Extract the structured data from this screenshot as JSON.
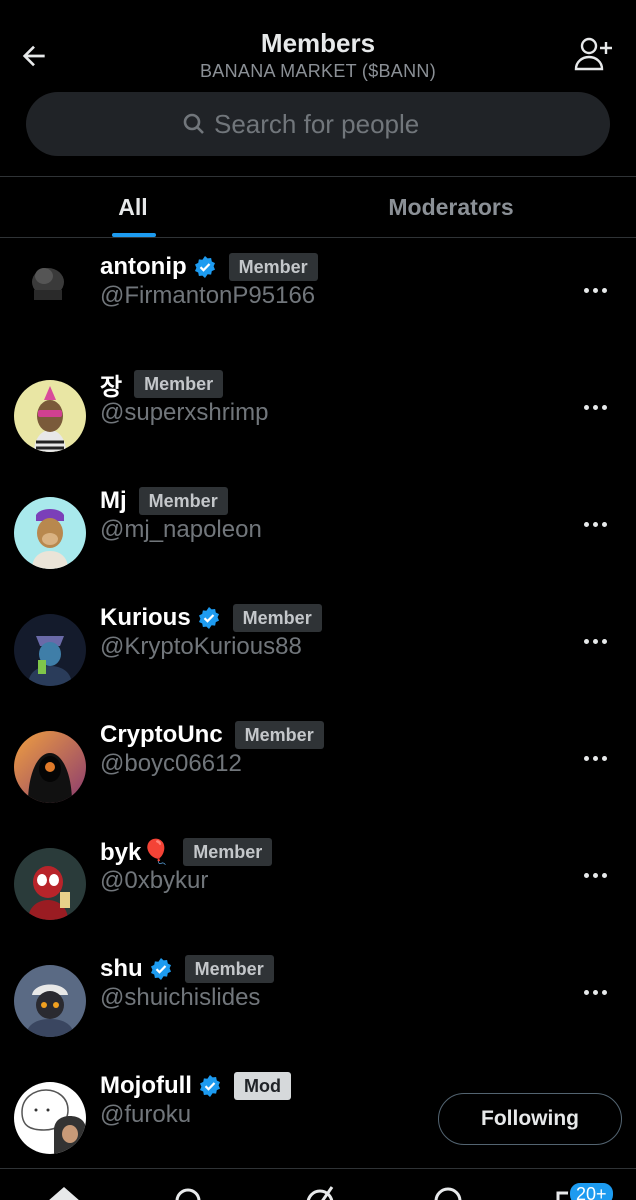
{
  "header": {
    "title": "Members",
    "subtitle": "BANANA MARKET ($BANN)"
  },
  "search": {
    "placeholder": "Search for people"
  },
  "tabs": [
    {
      "label": "All",
      "active": true
    },
    {
      "label": "Moderators",
      "active": false
    }
  ],
  "members": [
    {
      "name": "antonip",
      "handle": "@FirmantonP95166",
      "verified": true,
      "badge": "Member"
    },
    {
      "name": "장",
      "handle": "@superxshrimp",
      "verified": false,
      "badge": "Member"
    },
    {
      "name": "Mj",
      "handle": "@mj_napoleon",
      "verified": false,
      "badge": "Member"
    },
    {
      "name": "Kurious",
      "handle": "@KryptoKurious88",
      "verified": true,
      "badge": "Member"
    },
    {
      "name": "CryptoUnc",
      "handle": "@boyc06612",
      "verified": false,
      "badge": "Member"
    },
    {
      "name": "byk🎈",
      "handle": "@0xbykur",
      "verified": false,
      "badge": "Member"
    },
    {
      "name": "shu",
      "handle": "@shuichislides",
      "verified": true,
      "badge": "Member"
    },
    {
      "name": "Mojofull",
      "handle": "@furoku",
      "verified": true,
      "badge": "Mod",
      "action": "Following"
    }
  ],
  "bottom_nav": {
    "notification_count": "20+"
  },
  "colors": {
    "accent": "#1d9bf0",
    "background": "#000000",
    "muted": "#71767b"
  }
}
